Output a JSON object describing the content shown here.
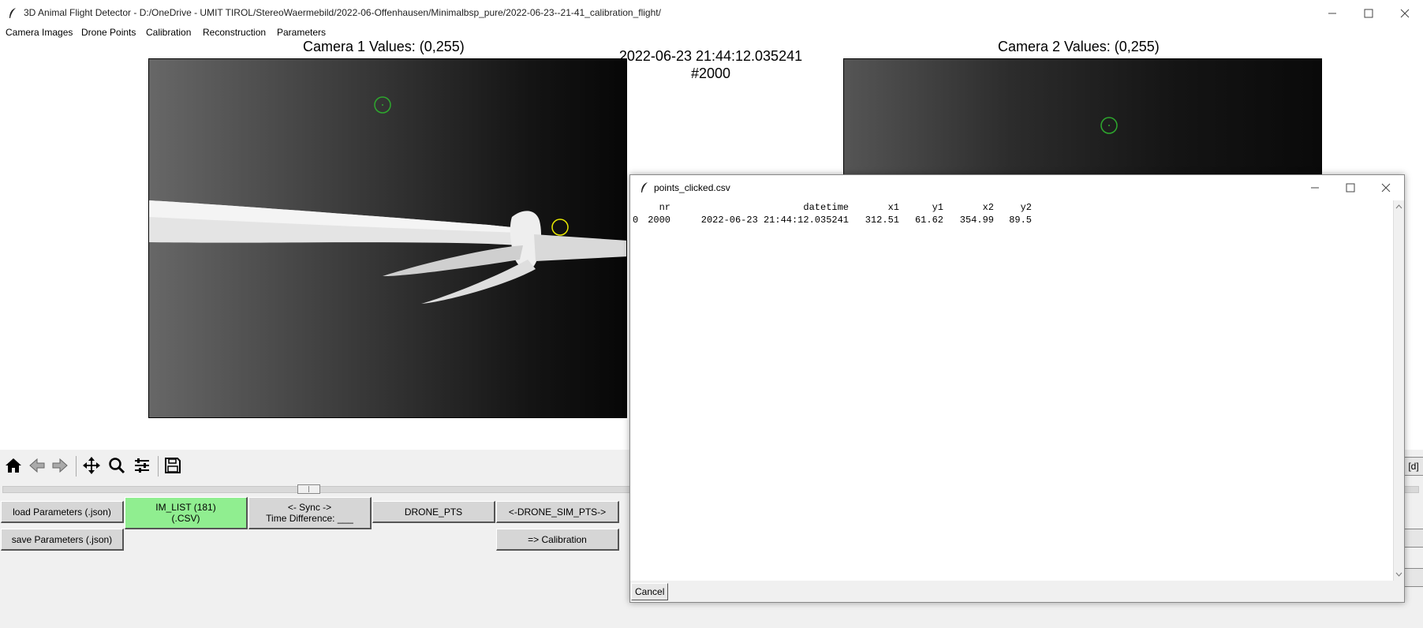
{
  "window": {
    "title": "3D Animal Flight Detector - D:/OneDrive - UMIT TIROL/StereoWaermebild/2022-06-Offenhausen/Minimalbsp_pure/2022-06-23--21-41_calibration_flight/"
  },
  "menu": [
    "Camera Images",
    "Drone Points",
    "Calibration",
    "Reconstruction",
    "Parameters"
  ],
  "camera1": {
    "title": "Camera 1 Values: (0,255)"
  },
  "camera2": {
    "title": "Camera 2 Values: (0,255)"
  },
  "frame": {
    "timestamp": "2022-06-23 21:44:12.035241",
    "number": "#2000"
  },
  "toolbar_icons": [
    "home-icon",
    "back-icon",
    "forward-icon",
    "pan-icon",
    "zoom-icon",
    "configure-icon",
    "save-icon"
  ],
  "buttons": {
    "load_params": "load Parameters (.json)",
    "save_params": "save Parameters (.json)",
    "im_list_line1": "IM_LIST (181)",
    "im_list_line2": "(.CSV)",
    "sync_line1": "<- Sync ->",
    "sync_line2": "Time Difference: ___",
    "drone_pts": "DRONE_PTS",
    "drone_sim_pts": "<-DRONE_SIM_PTS->",
    "calibration": "=> Calibration",
    "edge_d": "[d]"
  },
  "colors": {
    "active_button": "#90ee90",
    "marker_green": "#2ea82e",
    "marker_yellow": "#e8e800"
  },
  "dialog": {
    "title": "points_clicked.csv",
    "cancel": "Cancel",
    "columns": [
      "nr",
      "datetime",
      "x1",
      "y1",
      "x2",
      "y2"
    ],
    "rows": [
      {
        "index": "0",
        "nr": "2000",
        "datetime": "2022-06-23 21:44:12.035241",
        "x1": "312.51",
        "y1": "61.62",
        "x2": "354.99",
        "y2": "89.5"
      }
    ]
  }
}
